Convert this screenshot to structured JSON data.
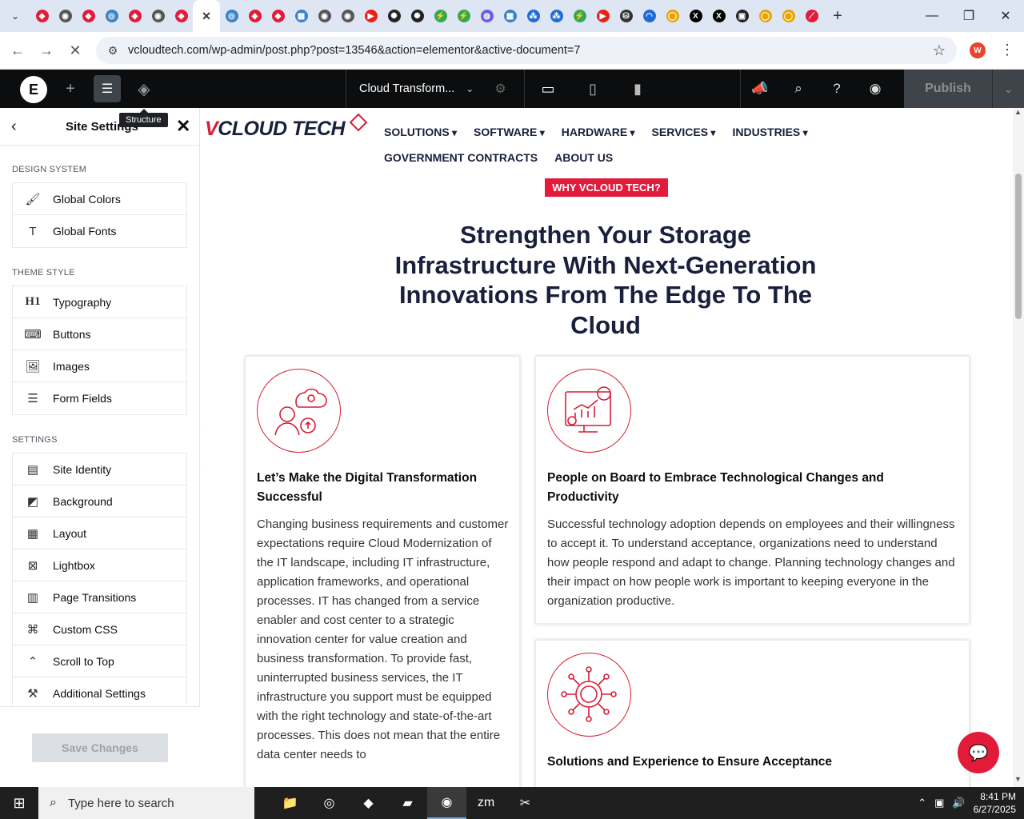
{
  "browser": {
    "tabs": [
      {
        "icon": "vcloud-favicon",
        "color": "#e31b3b",
        "glyph": "◆"
      },
      {
        "icon": "globe-favicon",
        "color": "#555555",
        "glyph": "◉"
      },
      {
        "icon": "vcloud-favicon",
        "color": "#e31b3b",
        "glyph": "◆"
      },
      {
        "icon": "edge-favicon",
        "color": "#3b82c4",
        "glyph": "◎"
      },
      {
        "icon": "vcloud-favicon",
        "color": "#e31b3b",
        "glyph": "◆"
      },
      {
        "icon": "globe-favicon",
        "color": "#555555",
        "glyph": "◉"
      },
      {
        "icon": "vcloud-favicon",
        "color": "#e31b3b",
        "glyph": "◆"
      },
      {
        "icon": "vcloud-favicon",
        "color": "#e31b3b",
        "glyph": "◆"
      },
      {
        "icon": "edge-favicon",
        "color": "#3b82c4",
        "glyph": "◎"
      },
      {
        "icon": "vcloud-favicon",
        "color": "#e31b3b",
        "glyph": "◆"
      },
      {
        "icon": "vcloud-favicon",
        "color": "#e31b3b",
        "glyph": "◆"
      },
      {
        "icon": "app-favicon",
        "color": "#3b82c4",
        "glyph": "▦"
      },
      {
        "icon": "globe-favicon",
        "color": "#555555",
        "glyph": "◉"
      },
      {
        "icon": "globe-favicon",
        "color": "#555555",
        "glyph": "◉"
      },
      {
        "icon": "youtube-favicon",
        "color": "#e62117",
        "glyph": "▶"
      },
      {
        "icon": "openai-favicon",
        "color": "#222222",
        "glyph": "✺"
      },
      {
        "icon": "openai-favicon",
        "color": "#222222",
        "glyph": "✺"
      },
      {
        "icon": "green-app-favicon",
        "color": "#34a853",
        "glyph": "⚡"
      },
      {
        "icon": "green-app-favicon",
        "color": "#34a853",
        "glyph": "⚡"
      },
      {
        "icon": "purple-favicon",
        "color": "#6c5ce7",
        "glyph": "◍"
      },
      {
        "icon": "app-favicon",
        "color": "#3b82c4",
        "glyph": "▦"
      },
      {
        "icon": "grid-favicon",
        "color": "#1e6bd6",
        "glyph": "⁂"
      },
      {
        "icon": "grid-favicon",
        "color": "#1e6bd6",
        "glyph": "⁂"
      },
      {
        "icon": "green-app-favicon",
        "color": "#34a853",
        "glyph": "⚡"
      },
      {
        "icon": "youtube-favicon",
        "color": "#e62117",
        "glyph": "▶"
      },
      {
        "icon": "lock-favicon",
        "color": "#333333",
        "glyph": "⛁"
      },
      {
        "icon": "wave-favicon",
        "color": "#1e6bd6",
        "glyph": "◠"
      },
      {
        "icon": "ring-favicon",
        "color": "#e8a300",
        "glyph": "◯"
      },
      {
        "icon": "x-favicon",
        "color": "#000000",
        "glyph": "X"
      },
      {
        "icon": "x-favicon",
        "color": "#000000",
        "glyph": "X"
      },
      {
        "icon": "dark-app-favicon",
        "color": "#222222",
        "glyph": "▣"
      },
      {
        "icon": "ring-favicon",
        "color": "#e8a300",
        "glyph": "◯"
      },
      {
        "icon": "ring-favicon",
        "color": "#e8a300",
        "glyph": "◯"
      },
      {
        "icon": "slash-favicon",
        "color": "#e31b3b",
        "glyph": "⟋"
      }
    ],
    "active_tab_index": 7,
    "url": "vcloudtech.com/wp-admin/post.php?post=13546&action=elementor&active-document=7",
    "profile_initial": "W"
  },
  "elementor": {
    "document_title": "Cloud Transform...",
    "publish_label": "Publish",
    "tooltip": "Structure"
  },
  "panel": {
    "title": "Site Settings",
    "sections": [
      {
        "title": "DESIGN SYSTEM",
        "items": [
          {
            "label": "Global Colors",
            "icon": "brush-icon",
            "glyph": "🖌"
          },
          {
            "label": "Global Fonts",
            "icon": "font-icon",
            "glyph": "T"
          }
        ]
      },
      {
        "title": "THEME STYLE",
        "items": [
          {
            "label": "Typography",
            "icon": "heading-icon",
            "glyph": "H1"
          },
          {
            "label": "Buttons",
            "icon": "button-icon",
            "glyph": "⌨"
          },
          {
            "label": "Images",
            "icon": "image-icon",
            "glyph": "🖼"
          },
          {
            "label": "Form Fields",
            "icon": "form-icon",
            "glyph": "☰"
          }
        ]
      },
      {
        "title": "SETTINGS",
        "items": [
          {
            "label": "Site Identity",
            "icon": "identity-icon",
            "glyph": "▤"
          },
          {
            "label": "Background",
            "icon": "background-icon",
            "glyph": "◩"
          },
          {
            "label": "Layout",
            "icon": "layout-icon",
            "glyph": "▦"
          },
          {
            "label": "Lightbox",
            "icon": "lightbox-icon",
            "glyph": "⊠"
          },
          {
            "label": "Page Transitions",
            "icon": "transitions-icon",
            "glyph": "▥"
          },
          {
            "label": "Custom CSS",
            "icon": "code-icon",
            "glyph": "⌘"
          },
          {
            "label": "Scroll to Top",
            "icon": "scroll-top-icon",
            "glyph": "⌃"
          },
          {
            "label": "Additional Settings",
            "icon": "tools-icon",
            "glyph": "⚒"
          }
        ]
      }
    ],
    "save_label": "Save Changes"
  },
  "site": {
    "logo_text_v": "V",
    "logo_text_rest": "CLOUD TECH",
    "nav": [
      "SOLUTIONS",
      "SOFTWARE",
      "HARDWARE",
      "SERVICES",
      "INDUSTRIES"
    ],
    "nav2": [
      "GOVERNMENT CONTRACTS",
      "ABOUT US"
    ],
    "why_label": "WHY VCLOUD TECH?",
    "hero": "Strengthen Your Storage Infrastructure With Next-Generation Innovations From The Edge To The Cloud",
    "cards": [
      {
        "title": "Let’s Make the Digital Transformation Successful",
        "body": "Changing business requirements and customer expectations require Cloud Modernization of the IT landscape, including IT infrastructure, application frameworks, and operational processes. IT has changed from a service enabler and cost center to a strategic innovation center for value creation and business transformation. To provide fast, uninterrupted business services, the IT infrastructure you support must be equipped with the right technology and state-of-the-art processes. This does not mean that the entire data center needs to"
      },
      {
        "title": "People on Board to Embrace Technological Changes and Productivity",
        "body": "Successful technology adoption depends on employees and their willingness to accept it. To understand acceptance, organizations need to understand how people respond and adapt to change. Planning technology changes and their impact on how people work is important to keeping everyone in the organization productive."
      },
      {
        "title": "Solutions and Experience to Ensure Acceptance",
        "body": ""
      }
    ],
    "accent": "#e31b3b",
    "navy": "#1a1f3c"
  },
  "taskbar": {
    "search_placeholder": "Type here to search",
    "time": "8:41 PM",
    "date": "6/27/2025"
  }
}
